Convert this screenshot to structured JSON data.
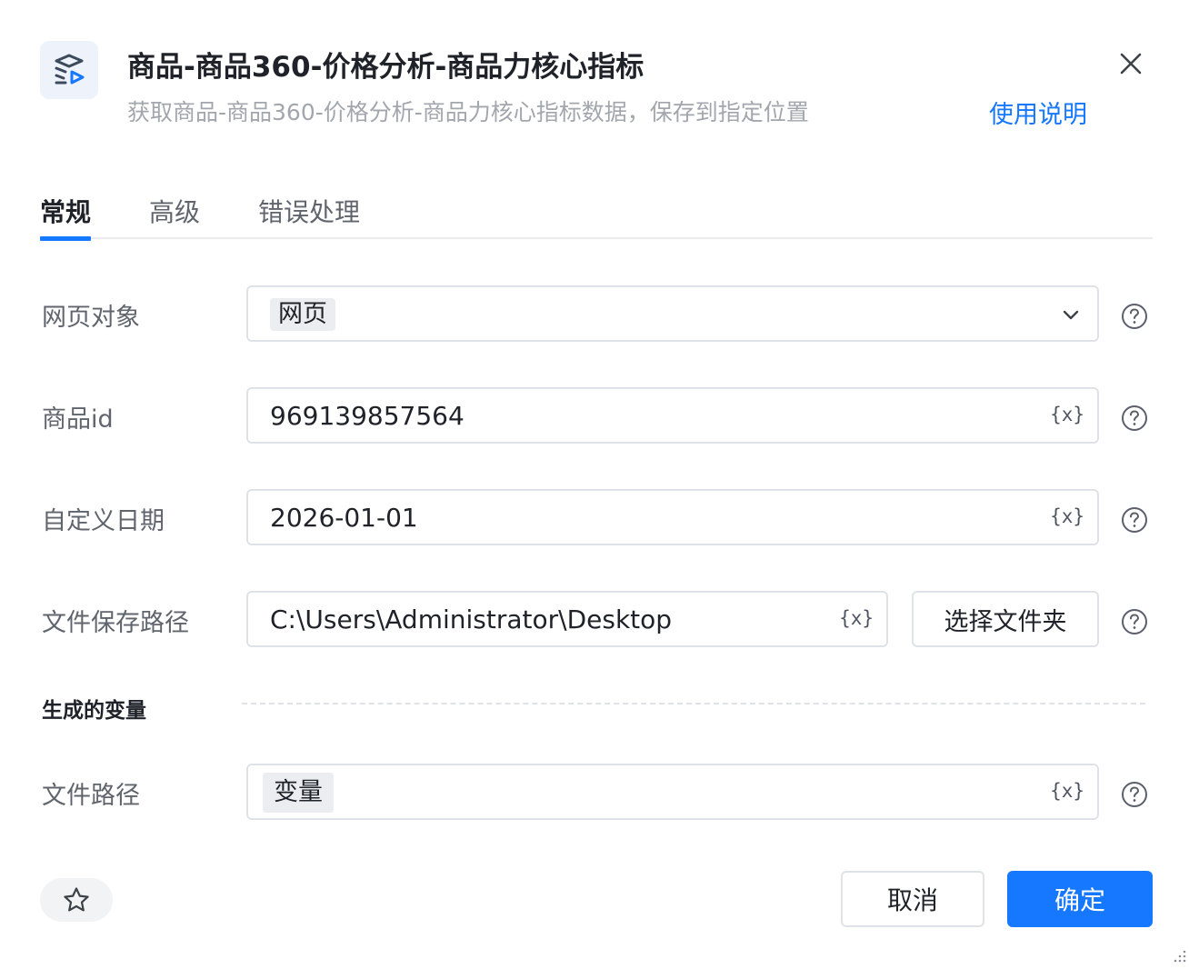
{
  "header": {
    "title": "商品-商品360-价格分析-商品力核心指标",
    "subtitle": "获取商品-商品360-价格分析-商品力核心指标数据，保存到指定位置",
    "help_link": "使用说明",
    "logo_icon": "layers-play-icon",
    "close_icon": "close-icon"
  },
  "tabs": [
    {
      "label": "常规",
      "active": true
    },
    {
      "label": "高级",
      "active": false
    },
    {
      "label": "错误处理",
      "active": false
    }
  ],
  "form": {
    "web_object": {
      "label": "网页对象",
      "value": "网页"
    },
    "product_id": {
      "label": "商品id",
      "value": "969139857564"
    },
    "custom_date": {
      "label": "自定义日期",
      "value": "2026-01-01"
    },
    "save_path": {
      "label": "文件保存路径",
      "value": "C:\\Users\\Administrator\\Desktop",
      "button": "选择文件夹"
    },
    "variable_marker": "{x}"
  },
  "outputs": {
    "section_title": "生成的变量",
    "file_path": {
      "label": "文件路径",
      "value": "变量"
    }
  },
  "footer": {
    "cancel": "取消",
    "confirm": "确定",
    "favorite_icon": "star-icon"
  },
  "colors": {
    "accent": "#1677ff",
    "text_primary": "#1f2329",
    "text_secondary": "#60656d",
    "border": "#dfe2e7"
  }
}
